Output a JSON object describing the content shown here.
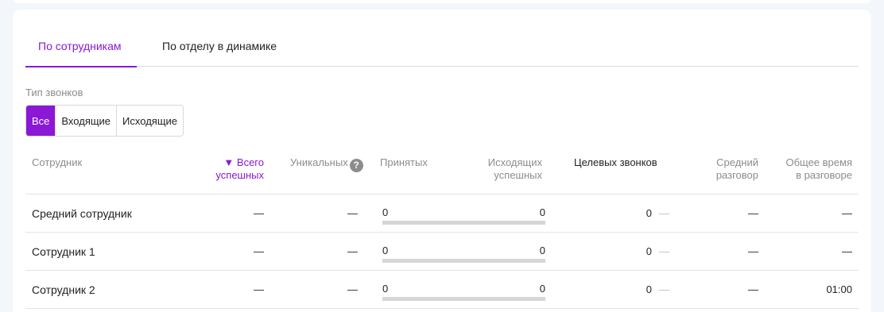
{
  "tabs": [
    {
      "label": "По сотрудникам",
      "active": true
    },
    {
      "label": "По отделу в динамике",
      "active": false
    }
  ],
  "filter": {
    "label": "Тип звонков",
    "options": [
      {
        "label": "Все",
        "active": true
      },
      {
        "label": "Входящие",
        "active": false
      },
      {
        "label": "Исходящие",
        "active": false
      }
    ]
  },
  "table": {
    "headers": {
      "employee": "Сотрудник",
      "total_success_1": "▼ Всего",
      "total_success_2": "успешных",
      "unique": "Уникальных",
      "accepted": "Принятых",
      "outgoing_1": "Исходящих",
      "outgoing_2": "успешных",
      "target": "Целевых звонков",
      "avg_1": "Средний",
      "avg_2": "разговор",
      "total_time_1": "Общее время",
      "total_time_2": "в разговоре"
    },
    "rows": [
      {
        "name": "Средний сотрудник",
        "total": "—",
        "unique": "—",
        "accepted": "0",
        "outgoing": "0",
        "target": "0",
        "target_extra": "—",
        "avg": "—",
        "total_time": "—"
      },
      {
        "name": "Сотрудник 1",
        "total": "—",
        "unique": "—",
        "accepted": "0",
        "outgoing": "0",
        "target": "0",
        "target_extra": "—",
        "avg": "—",
        "total_time": "—"
      },
      {
        "name": "Сотрудник 2",
        "total": "—",
        "unique": "—",
        "accepted": "0",
        "outgoing": "0",
        "target": "0",
        "target_extra": "—",
        "avg": "—",
        "total_time": "01:00"
      }
    ]
  },
  "colors": {
    "accent": "#8a18d6",
    "bar": "#d6d6d6"
  }
}
